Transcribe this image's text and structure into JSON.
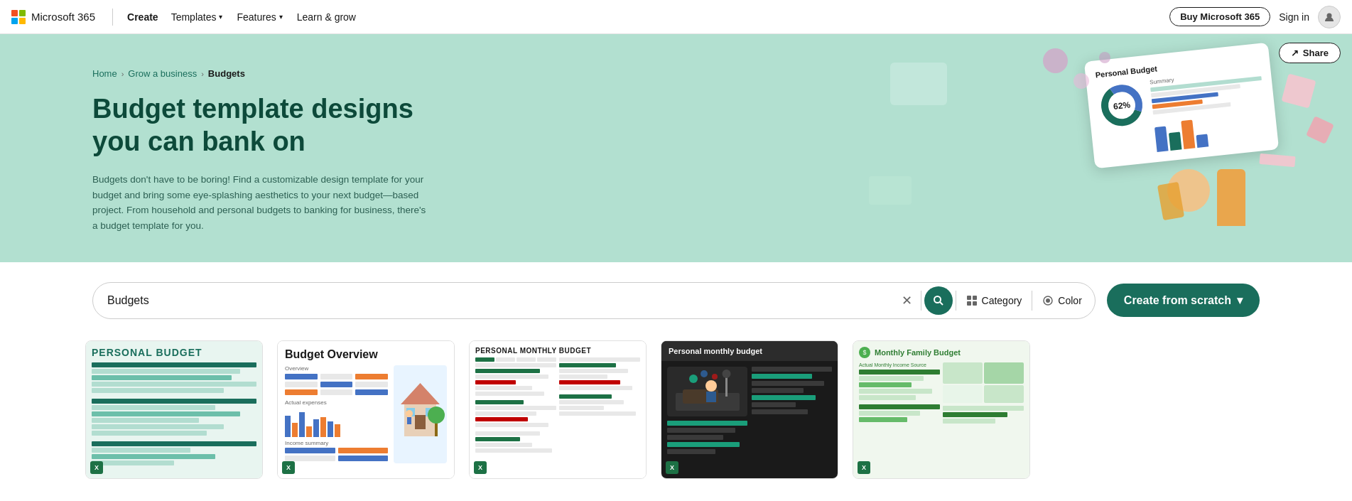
{
  "nav": {
    "brand": "Microsoft 365",
    "create": "Create",
    "templates_label": "Templates",
    "features_label": "Features",
    "learn_grow_label": "Learn & grow",
    "buy_label": "Buy Microsoft 365",
    "signin_label": "Sign in"
  },
  "hero": {
    "breadcrumb": {
      "home": "Home",
      "grow": "Grow a business",
      "current": "Budgets"
    },
    "title": "Budget template designs you can bank on",
    "description": "Budgets don't have to be boring! Find a customizable design template for your budget and bring some eye-splashing aesthetics to your next budget—based project. From household and personal budgets to banking for business, there's a budget template for you.",
    "share_label": "Share",
    "budget_percent": "62%"
  },
  "search": {
    "value": "Budgets",
    "placeholder": "Search",
    "category_label": "Category",
    "color_label": "Color",
    "create_label": "Create from scratch"
  },
  "templates": [
    {
      "title": "PERSONAL BUDGET",
      "type": "excel"
    },
    {
      "title": "Budget Overview",
      "type": "excel"
    },
    {
      "title": "PERSONAL MONTHLY BUDGET",
      "type": "excel"
    },
    {
      "title": "Personal monthly budget",
      "type": "excel",
      "dark": true
    },
    {
      "title": "Monthly Family Budget",
      "type": "excel"
    }
  ],
  "icons": {
    "share": "↗",
    "search": "🔍",
    "clear": "✕",
    "chevron": "▾",
    "category": "⊞",
    "color": "◉",
    "excel": "X"
  }
}
